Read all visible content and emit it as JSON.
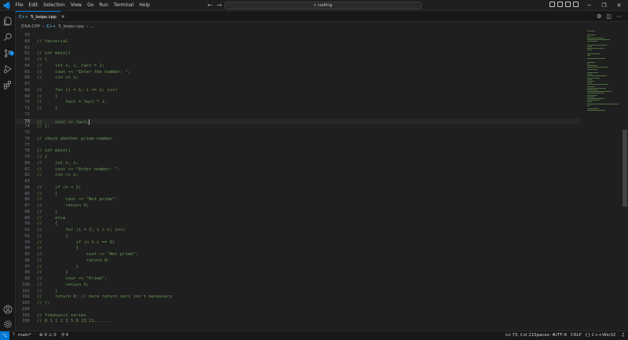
{
  "menu": [
    "File",
    "Edit",
    "Selection",
    "View",
    "Go",
    "Run",
    "Terminal",
    "Help"
  ],
  "search": {
    "text": "coding"
  },
  "tab": {
    "label": "5_loops.cpp",
    "icon": "C++"
  },
  "breadcrumbs": {
    "folder": "DSA-CPP",
    "file": "5_loops.cpp",
    "symbol": "..."
  },
  "editor": {
    "current_line": 73,
    "lines": [
      {
        "n": "59",
        "t": ""
      },
      {
        "n": "60",
        "t": "// factorial"
      },
      {
        "n": "61",
        "t": ""
      },
      {
        "n": "62",
        "t": "// int main()"
      },
      {
        "n": "63",
        "t": "// {"
      },
      {
        "n": "64",
        "t": "//     int n, i, fact = 1;"
      },
      {
        "n": "65",
        "t": "//     cout << \"Enter the number: \";"
      },
      {
        "n": "66",
        "t": "//     cin >> n;"
      },
      {
        "n": "67",
        "t": ""
      },
      {
        "n": "68",
        "t": "//     for (i = 1; i <= n; i++)"
      },
      {
        "n": "69",
        "t": "//     {"
      },
      {
        "n": "70",
        "t": "//         fact = fact * i;"
      },
      {
        "n": "71",
        "t": "//     }"
      },
      {
        "n": "72",
        "t": ""
      },
      {
        "n": "73",
        "t": "//     cout << fact;"
      },
      {
        "n": "74",
        "t": "// };"
      },
      {
        "n": "75",
        "t": ""
      },
      {
        "n": "76",
        "t": "// check whether prime number"
      },
      {
        "n": "77",
        "t": ""
      },
      {
        "n": "78",
        "t": "// int main()"
      },
      {
        "n": "79",
        "t": "// {"
      },
      {
        "n": "80",
        "t": "//     int n, i;"
      },
      {
        "n": "81",
        "t": "//     cout << \"Enter number: \";"
      },
      {
        "n": "82",
        "t": "//     cin >> n;"
      },
      {
        "n": "83",
        "t": ""
      },
      {
        "n": "84",
        "t": "//     if (n < 2)"
      },
      {
        "n": "85",
        "t": "//     {"
      },
      {
        "n": "86",
        "t": "//         cout << \"Not prime\";"
      },
      {
        "n": "87",
        "t": "//         return 0;"
      },
      {
        "n": "88",
        "t": "//     }"
      },
      {
        "n": "89",
        "t": "//     else"
      },
      {
        "n": "90",
        "t": "//     {"
      },
      {
        "n": "91",
        "t": "//         for (i = 2; i < n; i++)"
      },
      {
        "n": "92",
        "t": "//         {"
      },
      {
        "n": "93",
        "t": "//             if (n % i == 0)"
      },
      {
        "n": "94",
        "t": "//             {"
      },
      {
        "n": "95",
        "t": "//                 cout << \"Not prime\";"
      },
      {
        "n": "96",
        "t": "//                 return 0;"
      },
      {
        "n": "97",
        "t": "//             }"
      },
      {
        "n": "98",
        "t": "//         }"
      },
      {
        "n": "99",
        "t": "//         cout << \"Prime\";"
      },
      {
        "n": "100",
        "t": "//         return 0;"
      },
      {
        "n": "101",
        "t": "//     }"
      },
      {
        "n": "102",
        "t": "//     return 0; // here return zero isn't necessary"
      },
      {
        "n": "103",
        "t": "// };"
      },
      {
        "n": "104",
        "t": ""
      },
      {
        "n": "105",
        "t": "// fibonacci series"
      },
      {
        "n": "106",
        "t": "// 0 1 1 2 3 5 8 13 21......."
      }
    ]
  },
  "statusbar": {
    "branch": "main*",
    "problems": "⊗ 0 ⚠ 0",
    "ports": "⚲ 0",
    "position": "Ln 73, Col 21",
    "spaces": "Spaces: 4",
    "encoding": "UTF-8",
    "eol": "CRLF",
    "language": "{} C++",
    "platform": "Win32"
  },
  "colors": {
    "accent": "#0078d4",
    "comment": "#6a9955",
    "background": "#1f1f1f"
  },
  "icons": {
    "activity": [
      "explorer-icon",
      "search-icon",
      "source-control-icon",
      "run-debug-icon",
      "extensions-icon",
      "account-icon",
      "settings-gear-icon"
    ]
  }
}
